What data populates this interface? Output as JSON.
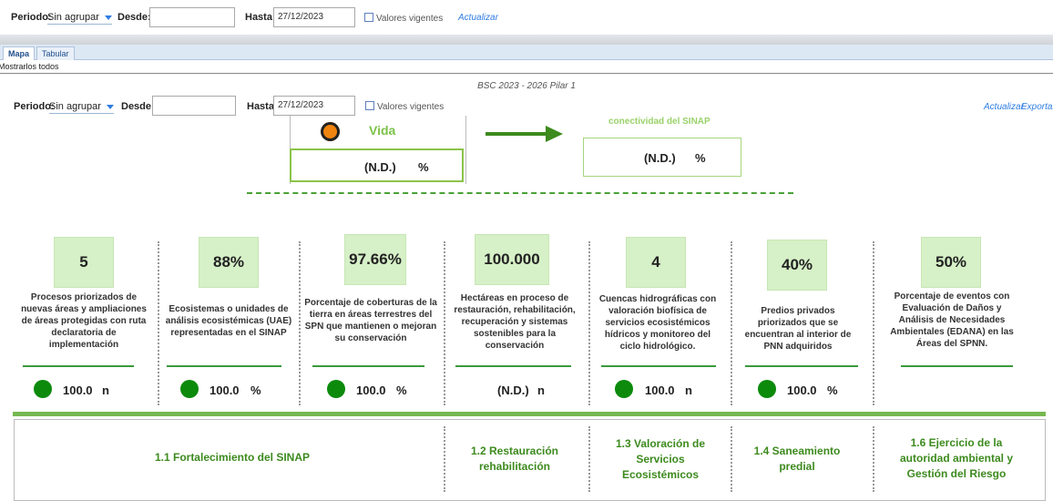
{
  "filter_top": {
    "period_label": "Periodo:",
    "period_value": "Sin agrupar",
    "desde_label": "Desde:",
    "desde_value": "",
    "hasta_label": "Hasta:",
    "hasta_value": "27/12/2023",
    "vigentes_label": "Valores vigentes",
    "actualizar_label": "Actualizar"
  },
  "tabs": [
    {
      "label": "Mapa",
      "active": true
    },
    {
      "label": "Tabular",
      "active": false
    }
  ],
  "show_all_label": "Mostrarlos todos",
  "report_title": "BSC 2023 - 2026 Pilar 1",
  "filter_inner": {
    "period_label": "Periodo:",
    "period_value": "Sin agrupar",
    "desde_label": "Desde:",
    "desde_value": "",
    "hasta_label": "Hasta:",
    "hasta_value": "27/12/2023",
    "vigentes_label": "Valores vigentes",
    "actualizar_label": "Actualizar",
    "exportar_label": "Exportar"
  },
  "objective_left": {
    "title": "Vida",
    "value": "(N.D.)",
    "unit": "%"
  },
  "objective_right": {
    "title": "conectividad del SINAP",
    "value": "(N.D.)",
    "unit": "%"
  },
  "kpis": [
    {
      "value": "5",
      "desc": "Procesos priorizados de nuevas áreas y ampliaciones de áreas protegidas con ruta declaratoria de implementación",
      "result": "100.0",
      "unit": "n",
      "status": "green"
    },
    {
      "value": "88%",
      "desc": "Ecosistemas o unidades de análisis ecosistémicas (UAE) representadas en el SINAP",
      "result": "100.0",
      "unit": "%",
      "status": "green"
    },
    {
      "value": "97.66%",
      "desc": "Porcentaje de coberturas de la tierra en áreas terrestres del SPN que mantienen o mejoran su conservación",
      "result": "100.0",
      "unit": "%",
      "status": "green"
    },
    {
      "value": "100.000",
      "desc": "Hectáreas en proceso de restauración, rehabilitación, recuperación y sistemas sostenibles para la conservación",
      "result": "(N.D.)",
      "unit": "n",
      "status": "none"
    },
    {
      "value": "4",
      "desc": "Cuencas hidrográficas con valoración biofísica de servicios ecosistémicos hídricos y monitoreo del ciclo hidrológico.",
      "result": "100.0",
      "unit": "n",
      "status": "green"
    },
    {
      "value": "40%",
      "desc": "Predios privados priorizados que se encuentran al interior de PNN adquiridos",
      "result": "100.0",
      "unit": "%",
      "status": "green"
    },
    {
      "value": "50%",
      "desc": "Porcentaje de eventos con Evaluación de Daños y Análisis de Necesidades Ambientales (EDANA) en las Áreas del SPNN.",
      "result": "",
      "unit": "",
      "status": "none"
    }
  ],
  "pillars": [
    {
      "label": "1.1 Fortalecimiento del SINAP"
    },
    {
      "label": "1.2 Restauración rehabilitación"
    },
    {
      "label": "1.3 Valoración de Servicios Ecosistémicos"
    },
    {
      "label": "1.4 Saneamiento predial"
    },
    {
      "label": "1.6 Ejercicio de la autoridad ambiental y Gestión del Riesgo"
    }
  ],
  "colors": {
    "green_status": "#0c8a0c",
    "kpi_bg": "#d6f0c7",
    "accent_green": "#3a9a3a",
    "link_blue": "#2f7de1"
  }
}
